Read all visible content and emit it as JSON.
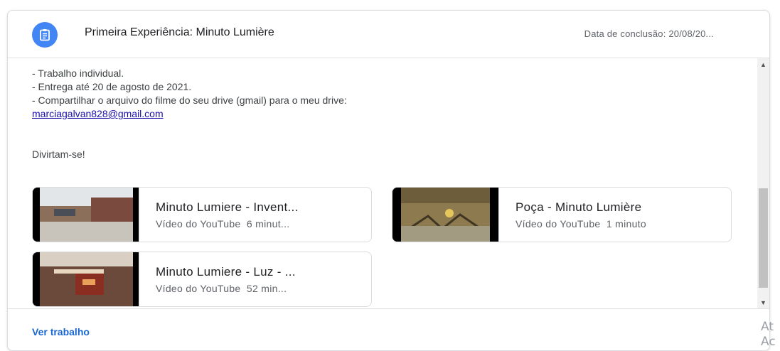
{
  "assignment": {
    "title": "Primeira Experiência: Minuto Lumière",
    "due_date": "Data de conclusão: 20/08/20...",
    "icon": "assignment-icon",
    "accent_color": "#4285f4"
  },
  "description": {
    "lines": [
      "- Trabalho individual.",
      "- Entrega até 20 de agosto de 2021.",
      "- Compartilhar o arquivo do filme do seu drive (gmail) para o meu drive:"
    ],
    "email_link": "marciagalvan828@gmail.com",
    "closing": "Divirtam-se!"
  },
  "attachments": [
    {
      "title": "Minuto Lumiere - Invent...",
      "source": "Vídeo do YouTube",
      "duration": "6 minut..."
    },
    {
      "title": "Poça - Minuto Lumière",
      "source": "Vídeo do YouTube",
      "duration": "1 minuto"
    },
    {
      "title": "Minuto Lumiere - Luz - ...",
      "source": "Vídeo do YouTube",
      "duration": "52 min..."
    }
  ],
  "footer": {
    "view_link": "Ver trabalho",
    "link_color": "#1967d2"
  },
  "overlay": {
    "watermark_text": "At\nAc"
  }
}
